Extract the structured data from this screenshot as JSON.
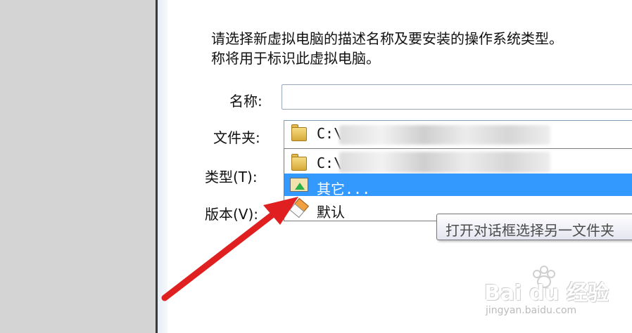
{
  "dialog": {
    "description_line1": "请选择新虚拟电脑的描述名称及要安装的操作系统类型。",
    "description_line2": "称将用于标识此虚拟电脑。",
    "name_label": "名称:",
    "name_value": "",
    "folder_label": "文件夹:",
    "type_label": "类型(T):",
    "version_label": "版本(V):"
  },
  "folder_combo": {
    "selected_text": "C:\\"
  },
  "dropdown": {
    "items": [
      {
        "label": "C:\\",
        "icon": "folder-icon"
      },
      {
        "label": "其它...",
        "icon": "other-folder-icon",
        "highlighted": true
      },
      {
        "label": "默认",
        "icon": "eraser-icon"
      }
    ]
  },
  "tooltip": {
    "text": "打开对话框选择另一文件夹"
  },
  "watermark": {
    "brand": "Bai du 经验",
    "url": "jingyan.baidu.com"
  },
  "colors": {
    "highlight": "#3399ff",
    "arrow": "#e02020",
    "left_pane": "#d4d4d4"
  }
}
